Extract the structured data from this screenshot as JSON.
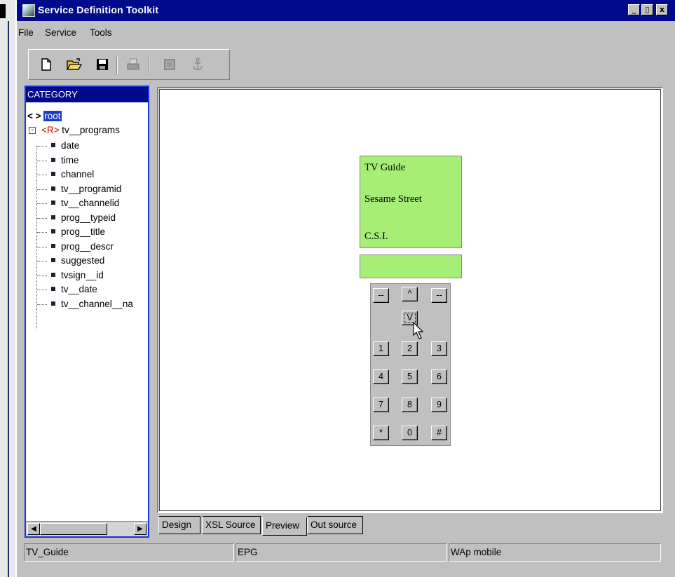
{
  "window": {
    "title": "Service Definition Toolkit",
    "controls": {
      "minimize": "_",
      "maximize": "▯",
      "close": "x"
    }
  },
  "menubar": [
    "File",
    "Service",
    "Tools"
  ],
  "toolbar": {
    "buttons": [
      "new-file",
      "open-folder",
      "save",
      "print",
      "grid",
      "anchor"
    ]
  },
  "tree": {
    "header": "CATEGORY",
    "root": {
      "marker": "< >",
      "label": "root"
    },
    "node": {
      "expander": "-",
      "marker": "<R>",
      "label": "tv__programs"
    },
    "leaves": [
      "date",
      "time",
      "channel",
      "tv__programid",
      "tv__channelid",
      "prog__typeid",
      "prog__title",
      "prog__descr",
      "suggested",
      "tvsign__id",
      "tv__date",
      "tv__channel__na"
    ]
  },
  "phone": {
    "screen_lines": [
      "TV Guide",
      "Sesame Street",
      "C.S.I."
    ],
    "input_value": "",
    "nav_keys": [
      "--",
      "^",
      "--",
      "V"
    ],
    "digit_keys": [
      "1",
      "2",
      "3",
      "4",
      "5",
      "6",
      "7",
      "8",
      "9",
      "*",
      "0",
      "#"
    ],
    "screen_color": "#a6ee76"
  },
  "tabs": {
    "items": [
      "Design",
      "XSL Source",
      "Preview",
      "Out source"
    ],
    "active": "Preview"
  },
  "statusbar": [
    "TV_Guide",
    "EPG",
    "WAp mobile"
  ],
  "colors": {
    "titlebar": "#000a8a",
    "selection": "#1a3ccc",
    "panel_border": "#1536e0"
  }
}
